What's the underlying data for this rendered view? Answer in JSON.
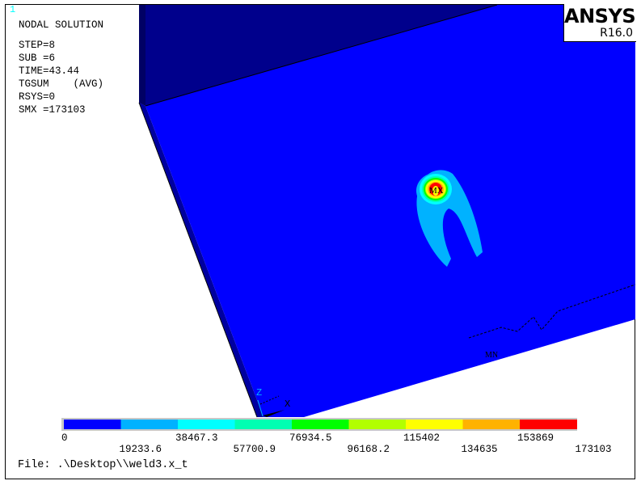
{
  "window_number": "1",
  "info": {
    "title": "NODAL SOLUTION",
    "step": "STEP=8",
    "sub": "SUB =6",
    "time": "TIME=43.44",
    "quantity": "TGSUM    (AVG)",
    "rsys": "RSYS=0",
    "smx": "SMX =173103"
  },
  "logo": {
    "name": "ANSYS",
    "version": "R16.0"
  },
  "markers": {
    "max": "MX",
    "min": "MN",
    "axis_z": "Z",
    "axis_x": "X"
  },
  "legend": {
    "colors": [
      "#0000ff",
      "#00b2ff",
      "#00ffff",
      "#00ffb2",
      "#00ff00",
      "#b2ff00",
      "#ffff00",
      "#ffb200",
      "#ff0000"
    ],
    "labels_top": [
      "0",
      "38467.3",
      "76934.5",
      "115402",
      "153869"
    ],
    "labels_bottom": [
      "19233.6",
      "57700.9",
      "96168.2",
      "134635",
      "173103"
    ]
  },
  "file": "File: .\\Desktop\\\\weld3.x_t"
}
